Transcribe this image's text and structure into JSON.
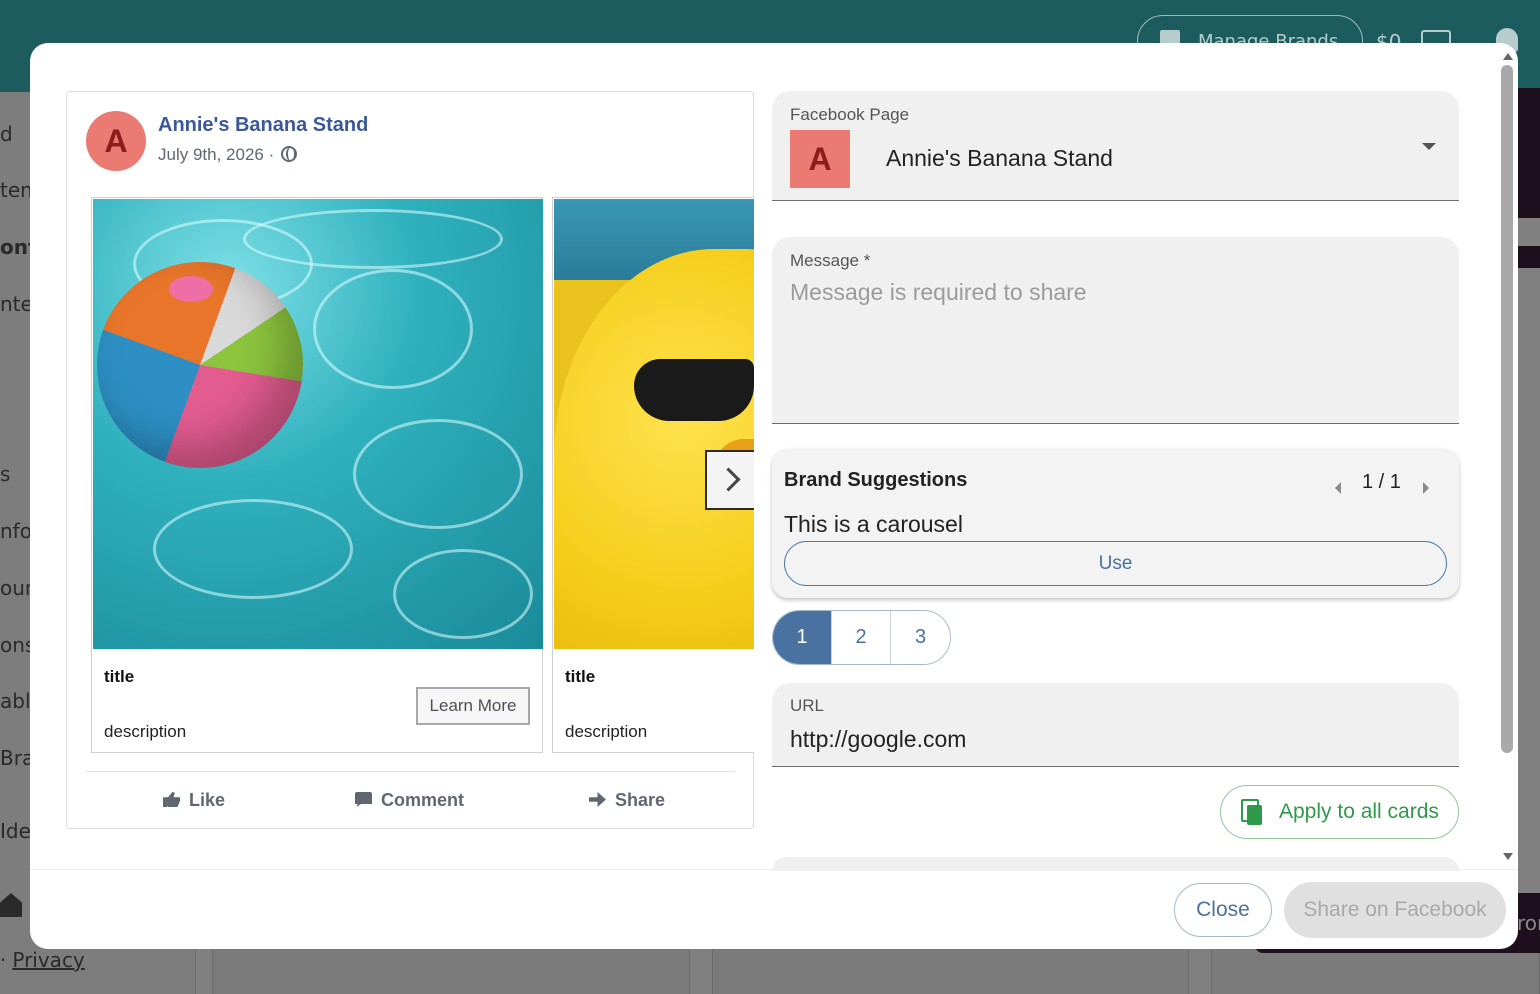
{
  "background_app": {
    "header": {
      "manage_brands_label": "Manage Brands",
      "credit_label": "$0"
    },
    "sidebar_partial_labels": [
      "d",
      "ten",
      "ont",
      "nte",
      "s",
      "nfo",
      "oun",
      "ons",
      "able",
      "Bra",
      "Ide"
    ],
    "footer_link_separator": "·",
    "footer_link_label": "Privacy",
    "right_button_partial_label": "ron"
  },
  "modal": {
    "preview": {
      "page_name": "Annie's Banana Stand",
      "avatar_letter": "A",
      "date": "July 9th, 2026 ·",
      "globe_icon": "globe-icon",
      "cards": [
        {
          "title": "title",
          "description": "description",
          "cta_label": "Learn More",
          "image": "beach-ball-in-pool"
        },
        {
          "title": "title",
          "description": "description",
          "image": "rubber-duck-with-sunglasses"
        }
      ],
      "actions": {
        "like": "Like",
        "comment": "Comment",
        "share": "Share"
      }
    },
    "form": {
      "facebook_page": {
        "label": "Facebook Page",
        "avatar_letter": "A",
        "value": "Annie's Banana Stand"
      },
      "message": {
        "label": "Message *",
        "value": "",
        "placeholder": "Message is required to share"
      },
      "brand_suggestions": {
        "title": "Brand Suggestions",
        "counter": "1 / 1",
        "text": "This is a carousel",
        "use_label": "Use"
      },
      "card_tabs": [
        {
          "label": "1",
          "active": true
        },
        {
          "label": "2",
          "active": false
        },
        {
          "label": "3",
          "active": false
        }
      ],
      "url": {
        "label": "URL",
        "value": "http://google.com"
      },
      "apply_all_label": "Apply to all cards"
    },
    "footer": {
      "close_label": "Close",
      "share_label": "Share on Facebook"
    },
    "colors": {
      "primary": "#4a72a0",
      "success": "#2f9a4a",
      "facebook_blue": "#3b5998",
      "avatar": "#ea7a72",
      "header_teal": "#1c5c5f"
    }
  }
}
